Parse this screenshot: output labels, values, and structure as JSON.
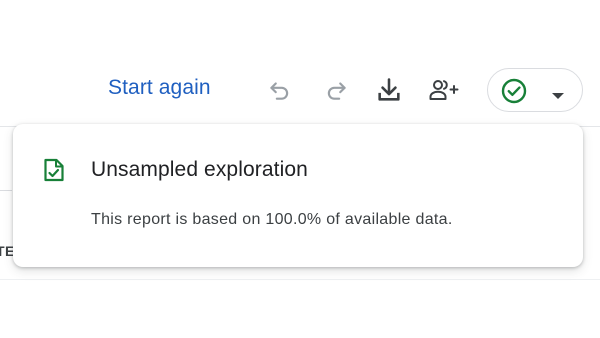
{
  "toolbar": {
    "start_again_label": "Start again",
    "icons": {
      "undo": "undo-icon",
      "redo": "redo-icon",
      "download": "download-icon",
      "share": "add-person-icon",
      "status": "check-circle-icon",
      "dropdown": "caret-down-icon"
    }
  },
  "popup": {
    "icon": "document-check-icon",
    "title": "Unsampled exploration",
    "description": "This report is based on 100.0% of available data."
  },
  "background": {
    "partial_text": "TE"
  },
  "colors": {
    "link_blue": "#1f5fc0",
    "success_green": "#188038",
    "icon_dark": "#3c4043",
    "icon_disabled": "#9aa0a6"
  }
}
